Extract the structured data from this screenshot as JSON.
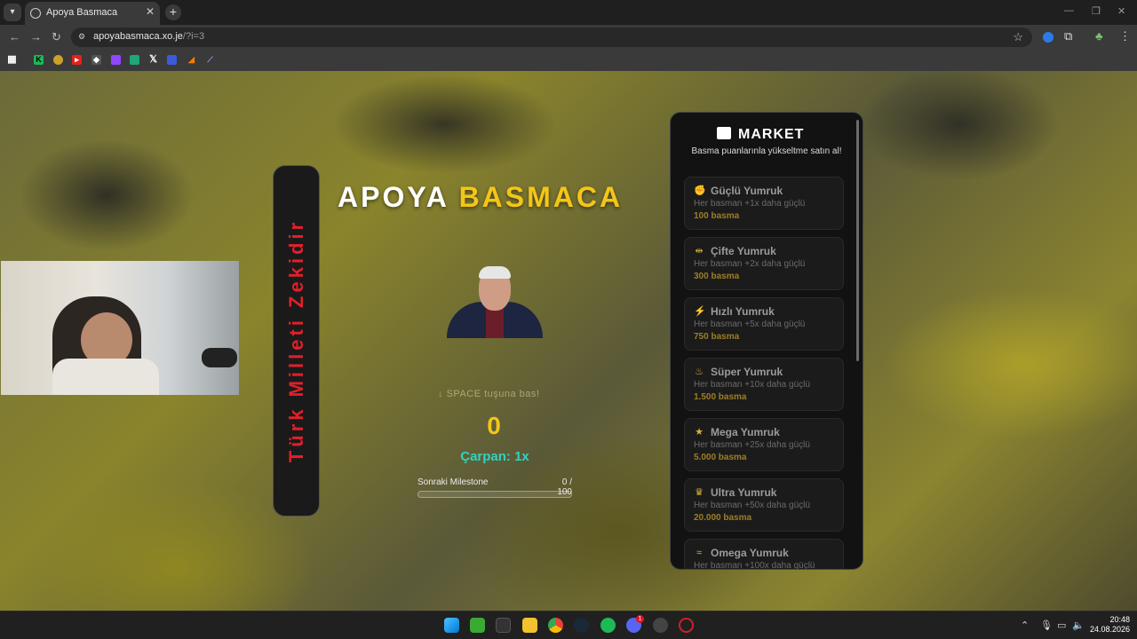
{
  "browser": {
    "tab_title": "Apoya Basmaca",
    "tab_close": "✕",
    "new_tab": "+",
    "url_host": "apoyabasmaca.xo.je",
    "url_path": "/?i=3"
  },
  "game": {
    "slogan": "Türk Milleti Zekidir",
    "title_part1": "APOYA",
    "title_part2": "BASMACA",
    "hint": "SPACE tuşuna bas!",
    "hint_icon": "arrow-down-icon",
    "score": "0",
    "multiplier": "Çarpan: 1x",
    "milestone_label": "Sonraki Milestone",
    "milestone_value": "0 / 100",
    "milestone_progress": 0
  },
  "market": {
    "title": "MARKET",
    "subtitle": "Basma puanlarınla yükseltme satın al!",
    "items": [
      {
        "name": "Güçlü Yumruk",
        "desc": "Her basman +1x daha güçlü",
        "price": "100 basma",
        "icon": "fist-icon"
      },
      {
        "name": "Çifte Yumruk",
        "desc": "Her basman +2x daha güçlü",
        "price": "300 basma",
        "icon": "dumbbell-icon"
      },
      {
        "name": "Hızlı Yumruk",
        "desc": "Her basman +5x daha güçlü",
        "price": "750 basma",
        "icon": "lightning-icon"
      },
      {
        "name": "Süper Yumruk",
        "desc": "Her basman +10x daha güçlü",
        "price": "1.500 basma",
        "icon": "fire-icon"
      },
      {
        "name": "Mega Yumruk",
        "desc": "Her basman +25x daha güçlü",
        "price": "5.000 basma",
        "icon": "star-icon"
      },
      {
        "name": "Ultra Yumruk",
        "desc": "Her basman +50x daha güçlü",
        "price": "20.000 basma",
        "icon": "crown-icon"
      },
      {
        "name": "Omega Yumruk",
        "desc": "Her basman +100x daha güçlü",
        "price": "",
        "icon": "dragon-icon"
      }
    ]
  },
  "taskbar": {
    "time": "20:48",
    "date": "24.08.2026",
    "discord_badge": "1"
  },
  "colors": {
    "accent_yellow": "#f5c518",
    "accent_teal": "#2fd3c0",
    "slogan_red": "#e0202a"
  }
}
